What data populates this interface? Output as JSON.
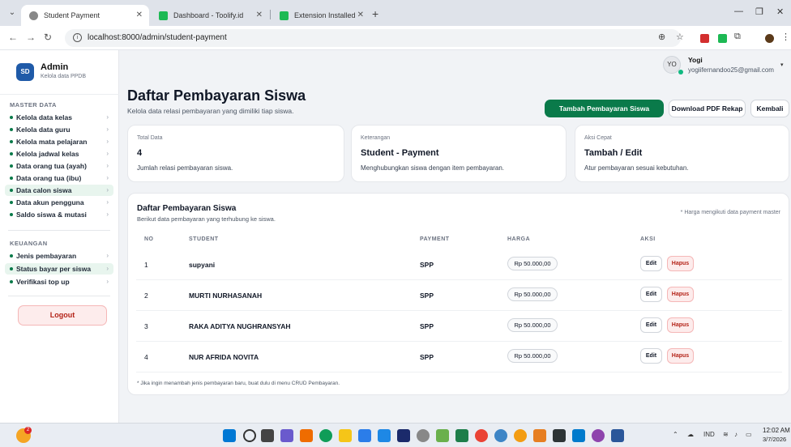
{
  "browser": {
    "tabs": [
      {
        "title": "Student Payment",
        "close": "✕",
        "active": true
      },
      {
        "title": "Dashboard - Toolify.id",
        "close": "✕",
        "active": false
      },
      {
        "title": "Extension Installed",
        "close": "✕",
        "active": false
      }
    ],
    "new_tab": "+",
    "url": "localhost:8000/admin/student-payment",
    "window_controls": {
      "minimize": "—",
      "restore": "❐",
      "close": "✕"
    }
  },
  "sidebar": {
    "brand_logo": "SD",
    "brand_name": "Admin",
    "brand_sub": "Kelola data PPDB",
    "section_master": "MASTER DATA",
    "master_items": [
      {
        "label": "Kelola data kelas"
      },
      {
        "label": "Kelola data guru"
      },
      {
        "label": "Kelola mata pelajaran"
      },
      {
        "label": "Kelola jadwal kelas"
      },
      {
        "label": "Data orang tua (ayah)"
      },
      {
        "label": "Data orang tua (ibu)"
      },
      {
        "label": "Data calon siswa"
      },
      {
        "label": "Data akun pengguna"
      },
      {
        "label": "Saldo siswa & mutasi"
      }
    ],
    "section_keuangan": "KEUANGAN",
    "keuangan_items": [
      {
        "label": "Jenis pembayaran"
      },
      {
        "label": "Status bayar per siswa"
      },
      {
        "label": "Verifikasi top up"
      }
    ],
    "chevron": "›",
    "logout_label": "Logout"
  },
  "user": {
    "initials": "YO",
    "name": "Yogi",
    "email": "yogiifernandoo25@gmail.com",
    "caret": "▾"
  },
  "header": {
    "title": "Daftar Pembayaran Siswa",
    "subtitle": "Kelola data relasi pembayaran yang dimiliki tiap siswa.",
    "btn_add": "Tambah Pembayaran Siswa",
    "btn_pdf": "Download PDF Rekap",
    "btn_back": "Kembali"
  },
  "stats": [
    {
      "label": "Total Data",
      "value": "4",
      "desc": "Jumlah relasi pembayaran siswa."
    },
    {
      "label": "Keterangan",
      "value": "Student - Payment",
      "desc": "Menghubungkan siswa dengan item pembayaran."
    },
    {
      "label": "Aksi Cepat",
      "value": "Tambah / Edit",
      "desc": "Atur pembayaran sesuai kebutuhan."
    }
  ],
  "table": {
    "title": "Daftar Pembayaran Siswa",
    "subtitle": "Berikut data pembayaran yang terhubung ke siswa.",
    "note": "* Harga mengikuti data payment master",
    "columns": [
      "NO",
      "STUDENT",
      "PAYMENT",
      "HARGA",
      "AKSI"
    ],
    "rows": [
      {
        "no": "1",
        "student": "supyani",
        "payment": "SPP",
        "harga": "Rp 50.000,00"
      },
      {
        "no": "2",
        "student": "MURTI NURHASANAH",
        "payment": "SPP",
        "harga": "Rp 50.000,00"
      },
      {
        "no": "3",
        "student": "RAKA ADITYA NUGHRANSYAH",
        "payment": "SPP",
        "harga": "Rp 50.000,00"
      },
      {
        "no": "4",
        "student": "NUR AFRIDA NOVITA",
        "payment": "SPP",
        "harga": "Rp 50.000,00"
      }
    ],
    "edit_label": "Edit",
    "delete_label": "Hapus",
    "footer_note": "* Jika ingin menambah jenis pembayaran baru, buat dulu di menu CRUD Pembayaran."
  },
  "taskbar": {
    "weather_badge": "2",
    "lang": "IND",
    "time": "12:02 AM",
    "date": "3/7/2026"
  },
  "colors": {
    "primary": "#0a7a4a",
    "danger": "#b42318",
    "danger_bg": "#fdecec"
  }
}
